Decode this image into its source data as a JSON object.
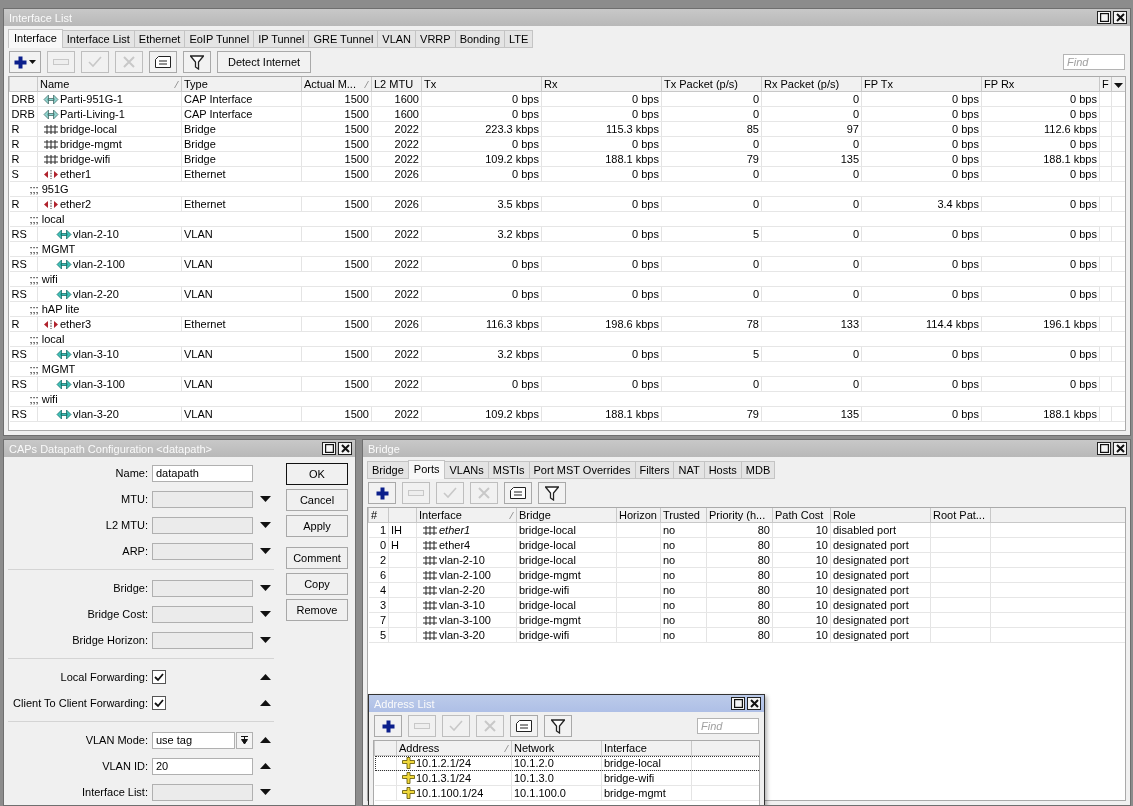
{
  "interface_window": {
    "title": "Interface List",
    "tabs": [
      {
        "label": "Interface",
        "selected": true
      },
      {
        "label": "Interface List",
        "selected": false
      },
      {
        "label": "Ethernet",
        "selected": false
      },
      {
        "label": "EoIP Tunnel",
        "selected": false
      },
      {
        "label": "IP Tunnel",
        "selected": false
      },
      {
        "label": "GRE Tunnel",
        "selected": false
      },
      {
        "label": "VLAN",
        "selected": false
      },
      {
        "label": "VRRP",
        "selected": false
      },
      {
        "label": "Bonding",
        "selected": false
      },
      {
        "label": "LTE",
        "selected": false
      }
    ],
    "toolbar": [
      {
        "kind": "add",
        "disabled": false,
        "menu": true
      },
      {
        "kind": "remove",
        "disabled": true
      },
      {
        "kind": "enable",
        "disabled": true
      },
      {
        "kind": "disable",
        "disabled": true
      },
      {
        "kind": "comment",
        "disabled": false
      },
      {
        "kind": "filter",
        "disabled": false
      },
      {
        "kind": "text",
        "label": "Detect Internet",
        "disabled": false
      }
    ],
    "search": {
      "placeholder": "Find"
    },
    "columns": [
      {},
      {
        "label": "Name",
        "sorted": true
      },
      {
        "label": "Type"
      },
      {
        "label": "Actual M...",
        "sorted": true
      },
      {
        "label": "L2 MTU"
      },
      {
        "label": "Tx"
      },
      {
        "label": "Rx"
      },
      {
        "label": "Tx Packet (p/s)"
      },
      {
        "label": "Rx Packet (p/s)"
      },
      {
        "label": "FP Tx"
      },
      {
        "label": "FP Rx"
      },
      {
        "label": "F"
      }
    ],
    "rows": [
      {
        "kind": "cap",
        "flags": "DRB",
        "name": "Parti-951G-1",
        "cells": [
          "CAP Interface",
          "1500",
          "1600",
          "0 bps",
          "0 bps",
          "0",
          "0",
          "0 bps",
          "0 bps"
        ]
      },
      {
        "kind": "cap",
        "flags": "DRB",
        "name": "Parti-Living-1",
        "cells": [
          "CAP Interface",
          "1500",
          "1600",
          "0 bps",
          "0 bps",
          "0",
          "0",
          "0 bps",
          "0 bps"
        ]
      },
      {
        "kind": "bridge",
        "flags": "R",
        "name": "bridge-local",
        "cells": [
          "Bridge",
          "1500",
          "2022",
          "223.3 kbps",
          "115.3 kbps",
          "85",
          "97",
          "0 bps",
          "112.6 kbps"
        ]
      },
      {
        "kind": "bridge",
        "flags": "R",
        "name": "bridge-mgmt",
        "cells": [
          "Bridge",
          "1500",
          "2022",
          "0 bps",
          "0 bps",
          "0",
          "0",
          "0 bps",
          "0 bps"
        ]
      },
      {
        "kind": "bridge",
        "flags": "R",
        "name": "bridge-wifi",
        "cells": [
          "Bridge",
          "1500",
          "2022",
          "109.2 kbps",
          "188.1 kbps",
          "79",
          "135",
          "0 bps",
          "188.1 kbps"
        ]
      },
      {
        "kind": "ether",
        "flags": "S",
        "name": "ether1",
        "cells": [
          "Ethernet",
          "1500",
          "2026",
          "0 bps",
          "0 bps",
          "0",
          "0",
          "0 bps",
          "0 bps"
        ]
      },
      {
        "kind": "comment",
        "text": ";;; 951G"
      },
      {
        "kind": "ether",
        "flags": "R",
        "name": "ether2",
        "cells": [
          "Ethernet",
          "1500",
          "2026",
          "3.5 kbps",
          "0 bps",
          "0",
          "0",
          "3.4 kbps",
          "0 bps"
        ]
      },
      {
        "kind": "comment",
        "text": ";;; local"
      },
      {
        "kind": "vlan",
        "flags": "RS",
        "name": "vlan-2-10",
        "cells": [
          "VLAN",
          "1500",
          "2022",
          "3.2 kbps",
          "0 bps",
          "5",
          "0",
          "0 bps",
          "0 bps"
        ]
      },
      {
        "kind": "comment",
        "text": ";;; MGMT"
      },
      {
        "kind": "vlan",
        "flags": "RS",
        "name": "vlan-2-100",
        "cells": [
          "VLAN",
          "1500",
          "2022",
          "0 bps",
          "0 bps",
          "0",
          "0",
          "0 bps",
          "0 bps"
        ]
      },
      {
        "kind": "comment",
        "text": ";;; wifi"
      },
      {
        "kind": "vlan",
        "flags": "RS",
        "name": "vlan-2-20",
        "cells": [
          "VLAN",
          "1500",
          "2022",
          "0 bps",
          "0 bps",
          "0",
          "0",
          "0 bps",
          "0 bps"
        ]
      },
      {
        "kind": "comment",
        "text": ";;; hAP lite"
      },
      {
        "kind": "ether",
        "flags": "R",
        "name": "ether3",
        "cells": [
          "Ethernet",
          "1500",
          "2026",
          "116.3 kbps",
          "198.6 kbps",
          "78",
          "133",
          "114.4 kbps",
          "196.1 kbps"
        ]
      },
      {
        "kind": "comment",
        "text": ";;; local"
      },
      {
        "kind": "vlan",
        "flags": "RS",
        "name": "vlan-3-10",
        "cells": [
          "VLAN",
          "1500",
          "2022",
          "3.2 kbps",
          "0 bps",
          "5",
          "0",
          "0 bps",
          "0 bps"
        ]
      },
      {
        "kind": "comment",
        "text": ";;; MGMT"
      },
      {
        "kind": "vlan",
        "flags": "RS",
        "name": "vlan-3-100",
        "cells": [
          "VLAN",
          "1500",
          "2022",
          "0 bps",
          "0 bps",
          "0",
          "0",
          "0 bps",
          "0 bps"
        ]
      },
      {
        "kind": "comment",
        "text": ";;; wifi"
      },
      {
        "kind": "vlan",
        "flags": "RS",
        "name": "vlan-3-20",
        "cells": [
          "VLAN",
          "1500",
          "2022",
          "109.2 kbps",
          "188.1 kbps",
          "79",
          "135",
          "0 bps",
          "188.1 kbps"
        ]
      }
    ]
  },
  "caps_window": {
    "title": "CAPs Datapath Configuration <datapath>",
    "sections": [
      {
        "fields": [
          {
            "label": "Name:",
            "kind": "text",
            "value": "datapath"
          },
          {
            "label": "MTU:",
            "kind": "dropdown",
            "enabled": false
          },
          {
            "label": "L2 MTU:",
            "kind": "dropdown",
            "enabled": false
          },
          {
            "label": "ARP:",
            "kind": "dropdown",
            "enabled": false
          }
        ]
      },
      {
        "fields": [
          {
            "label": "Bridge:",
            "kind": "dropdown",
            "enabled": false
          },
          {
            "label": "Bridge Cost:",
            "kind": "dropdown",
            "enabled": false
          },
          {
            "label": "Bridge Horizon:",
            "kind": "dropdown",
            "enabled": false
          }
        ]
      },
      {
        "fields": [
          {
            "label": "Local Forwarding:",
            "kind": "checkbox",
            "checked": true,
            "enabled": true
          },
          {
            "label": "Client To Client Forwarding:",
            "kind": "checkbox",
            "checked": true,
            "enabled": true
          }
        ]
      },
      {
        "fields": [
          {
            "label": "VLAN Mode:",
            "kind": "combo",
            "value": "use tag",
            "enabled": true
          },
          {
            "label": "VLAN ID:",
            "kind": "dropdown",
            "value": "20",
            "enabled": true
          },
          {
            "label": "Interface List:",
            "kind": "dropdown",
            "enabled": false
          }
        ]
      }
    ],
    "buttons": [
      {
        "label": "OK",
        "selected": true
      },
      {
        "label": "Cancel",
        "selected": false
      },
      {
        "label": "Apply",
        "selected": false
      },
      {
        "label": "Comment",
        "selected": false
      },
      {
        "label": "Copy",
        "selected": false
      },
      {
        "label": "Remove",
        "selected": false
      }
    ]
  },
  "bridge_window": {
    "title": "Bridge",
    "tabs": [
      {
        "label": "Bridge",
        "selected": false
      },
      {
        "label": "Ports",
        "selected": true
      },
      {
        "label": "VLANs",
        "selected": false
      },
      {
        "label": "MSTIs",
        "selected": false
      },
      {
        "label": "Port MST Overrides",
        "selected": false
      },
      {
        "label": "Filters",
        "selected": false
      },
      {
        "label": "NAT",
        "selected": false
      },
      {
        "label": "Hosts",
        "selected": false
      },
      {
        "label": "MDB",
        "selected": false
      }
    ],
    "toolbar": [
      {
        "kind": "add",
        "disabled": false
      },
      {
        "kind": "remove",
        "disabled": true
      },
      {
        "kind": "enable",
        "disabled": true
      },
      {
        "kind": "disable",
        "disabled": true
      },
      {
        "kind": "comment",
        "disabled": false
      },
      {
        "kind": "filter",
        "disabled": false
      }
    ],
    "columns": [
      {
        "label": "#"
      },
      {},
      {
        "label": "Interface",
        "sorted": true
      },
      {
        "label": "Bridge"
      },
      {
        "label": "Horizon"
      },
      {
        "label": "Trusted"
      },
      {
        "label": "Priority (h..."
      },
      {
        "label": "Path Cost"
      },
      {
        "label": "Role"
      },
      {
        "label": "Root Pat..."
      }
    ],
    "rows": [
      {
        "number": "1",
        "flags": "IH",
        "interface": "ether1",
        "disabled": true,
        "bridge": "bridge-local",
        "trusted": "no",
        "priority": "80",
        "path_cost": "10",
        "role": "disabled port"
      },
      {
        "number": "0",
        "flags": "H",
        "interface": "ether4",
        "disabled": false,
        "bridge": "bridge-local",
        "trusted": "no",
        "priority": "80",
        "path_cost": "10",
        "role": "designated port"
      },
      {
        "number": "2",
        "interface": "vlan-2-10",
        "disabled": false,
        "bridge": "bridge-local",
        "trusted": "no",
        "priority": "80",
        "path_cost": "10",
        "role": "designated port"
      },
      {
        "number": "6",
        "interface": "vlan-2-100",
        "disabled": false,
        "bridge": "bridge-mgmt",
        "trusted": "no",
        "priority": "80",
        "path_cost": "10",
        "role": "designated port"
      },
      {
        "number": "4",
        "interface": "vlan-2-20",
        "disabled": false,
        "bridge": "bridge-wifi",
        "trusted": "no",
        "priority": "80",
        "path_cost": "10",
        "role": "designated port"
      },
      {
        "number": "3",
        "interface": "vlan-3-10",
        "disabled": false,
        "bridge": "bridge-local",
        "trusted": "no",
        "priority": "80",
        "path_cost": "10",
        "role": "designated port"
      },
      {
        "number": "7",
        "interface": "vlan-3-100",
        "disabled": false,
        "bridge": "bridge-mgmt",
        "trusted": "no",
        "priority": "80",
        "path_cost": "10",
        "role": "designated port"
      },
      {
        "number": "5",
        "interface": "vlan-3-20",
        "disabled": false,
        "bridge": "bridge-wifi",
        "trusted": "no",
        "priority": "80",
        "path_cost": "10",
        "role": "designated port"
      }
    ]
  },
  "address_window": {
    "title": "Address List",
    "toolbar": [
      {
        "kind": "add",
        "disabled": false
      },
      {
        "kind": "remove",
        "disabled": true
      },
      {
        "kind": "enable",
        "disabled": true
      },
      {
        "kind": "disable",
        "disabled": true
      },
      {
        "kind": "comment",
        "disabled": false
      },
      {
        "kind": "filter",
        "disabled": false
      }
    ],
    "search": {
      "placeholder": "Find"
    },
    "columns": [
      {},
      {
        "label": "Address",
        "sorted": true
      },
      {
        "label": "Network"
      },
      {
        "label": "Interface"
      }
    ],
    "rows": [
      {
        "address": "10.1.2.1/24",
        "network": "10.1.2.0",
        "interface": "bridge-local",
        "selected": true
      },
      {
        "address": "10.1.3.1/24",
        "network": "10.1.3.0",
        "interface": "bridge-wifi",
        "selected": false
      },
      {
        "address": "10.1.100.1/24",
        "network": "10.1.100.0",
        "interface": "bridge-mgmt",
        "selected": false
      }
    ]
  }
}
